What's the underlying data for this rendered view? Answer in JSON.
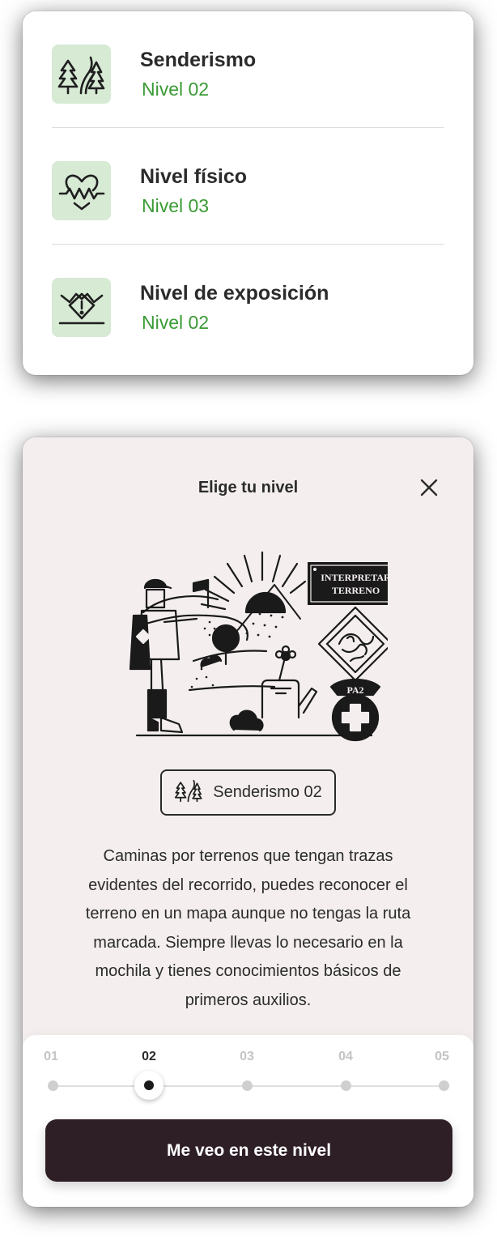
{
  "levels": [
    {
      "icon": "hiking-trees-icon",
      "title": "Senderismo",
      "value": "Nivel 02"
    },
    {
      "icon": "heart-pulse-icon",
      "title": "Nivel físico",
      "value": "Nivel 03"
    },
    {
      "icon": "exposure-warning-icon",
      "title": "Nivel de exposición",
      "value": "Nivel 02"
    }
  ],
  "colors": {
    "accent_green": "#3a9b35",
    "icon_tile_bg": "#d6ead4",
    "modal_bg": "#f4efee",
    "cta_bg": "#2e1e25"
  },
  "modal": {
    "title": "Elige tu nivel",
    "close_icon": "close-icon",
    "illustration": {
      "sign_line1": "INTERPRETAR",
      "sign_line2": "TERRENO",
      "medal_text": "PA2"
    },
    "badge": {
      "icon": "hiking-trees-icon",
      "label": "Senderismo 02"
    },
    "description_lines": [
      "Caminas por terrenos que tengan trazas",
      "evidentes del recorrido, puedes reconocer el",
      "terreno en un mapa aunque no tengas la ruta",
      "marcada. Siempre llevas lo necesario en la",
      "mochila y tienes conocimientos básicos de",
      "primeros auxilios."
    ],
    "steps": [
      "01",
      "02",
      "03",
      "04",
      "05"
    ],
    "selected_step": "02",
    "cta_label": "Me veo en este nivel"
  }
}
